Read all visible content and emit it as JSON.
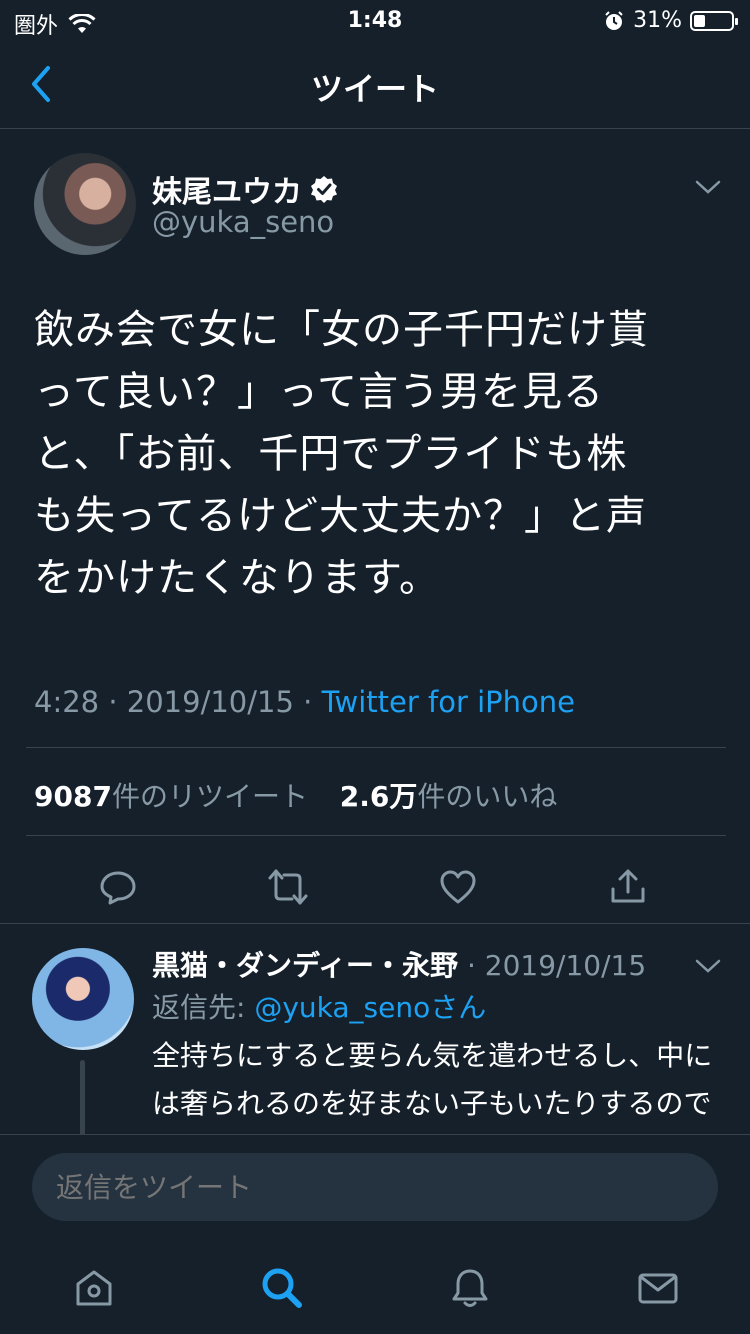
{
  "status_bar": {
    "carrier": "圏外",
    "time": "1:48",
    "battery": "31%",
    "battery_level": 0.31
  },
  "nav": {
    "title": "ツイート"
  },
  "tweet": {
    "author_name": "妹尾ユウカ",
    "author_handle": "@yuka_seno",
    "text_lines": [
      "飲み会で女に「女の子千円だけ貰",
      "って良い？」って言う男を見る",
      "と、「お前、千円でプライドも株",
      "も失ってるけど大丈夫か？」と声",
      "をかけたくなります。"
    ],
    "time": "4:28",
    "date": "2019/10/15",
    "source": "Twitter for iPhone",
    "retweet_count": "9087",
    "retweet_label": "件のリツイート",
    "like_count": "2.6万",
    "like_label": "件のいいね"
  },
  "reply": {
    "author_name": "黒猫・ダンディー・永野",
    "date": "2019/10/15",
    "reply_prefix": "返信先: ",
    "reply_mention": "@yuka_seno",
    "reply_suffix": "さん",
    "text": "全持ちにすると要らん気を遣わせるし、中には奢られるのを好まない子もいたりするのですよ。"
  },
  "compose": {
    "placeholder": "返信をツイート"
  },
  "colors": {
    "background": "#15202b",
    "accent": "#1da1f2",
    "secondary_text": "#8899a6",
    "divider": "#38444d"
  }
}
